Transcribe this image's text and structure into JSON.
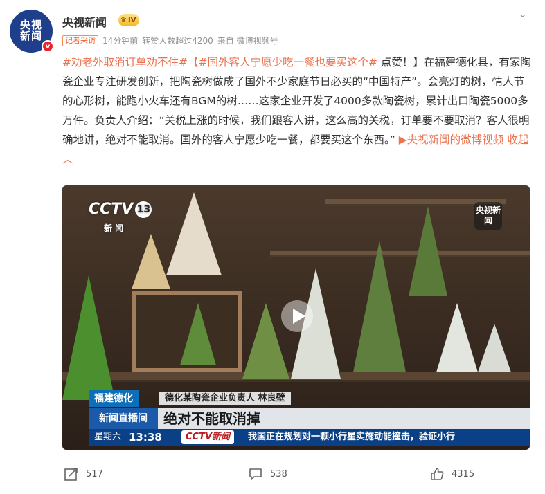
{
  "post": {
    "author": "央视新闻",
    "avatar_line1": "央视",
    "avatar_line2": "新闻",
    "verified_badge": "v",
    "level_badge": "IV",
    "meta": {
      "tag": "记者采访",
      "time": "14分钟前",
      "reposts": "转赞人数超过4200",
      "source": "来自 微博视频号"
    },
    "topic1": "#劝老外取消订单劝不住#",
    "topic2": "【#国外客人宁愿少吃一餐也要买这个#",
    "body": " 点赞！】在福建德化县，有家陶瓷企业专注研发创新，把陶瓷树做成了国外不少家庭节日必买的“中国特产”。会亮灯的树，情人节的心形树，能跑小火车还有BGM的树……这家企业开发了4000多款陶瓷树，累计出口陶瓷5000多万件。负责人介绍：“关税上涨的时候，我们跟客人讲，这么高的关税，订单要不要取消？客人很明确地讲，绝对不能取消。国外的客人宁愿少吃一餐，都要买这个东西。”",
    "video_link": "央视新闻的微博视频",
    "collapse": "收起"
  },
  "video": {
    "channel_logo": "CCTV",
    "channel_number": "13",
    "channel_sub": "新 闻",
    "watermark": "央视新闻",
    "location": "福建德化",
    "speaker": "德化某陶瓷企业负责人 林良壁",
    "show_name": "新闻直播间",
    "headline": "绝对不能取消掉",
    "weekday": "星期六",
    "clock": "13:38",
    "ticker_logo": "CCTV新闻",
    "ticker_text": "我国正在规划对一颗小行星实施动能撞击，验证小行"
  },
  "actions": {
    "share_count": "517",
    "comment_count": "538",
    "like_count": "4315"
  }
}
